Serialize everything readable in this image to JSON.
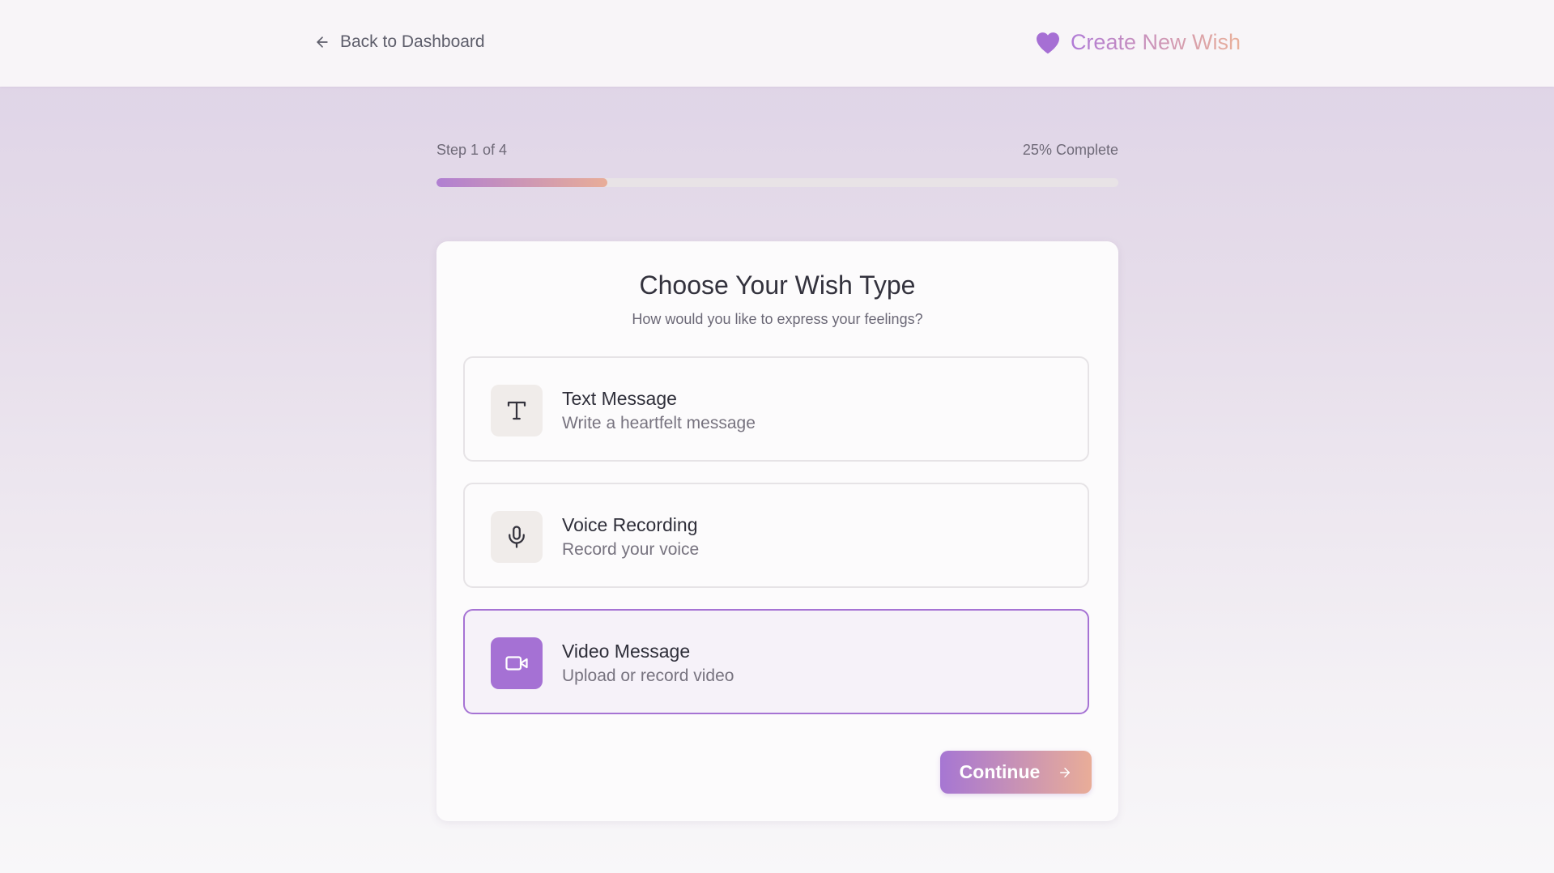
{
  "header": {
    "back_label": "Back to Dashboard",
    "title": "Create New Wish",
    "brand_icon": "heart-icon"
  },
  "progress": {
    "step_label": "Step 1 of 4",
    "percent_label": "25% Complete",
    "fraction": 0.25
  },
  "card": {
    "title": "Choose Your Wish Type",
    "subtitle": "How would you like to express your feelings?",
    "options": [
      {
        "title": "Text Message",
        "description": "Write a heartfelt message",
        "icon": "text-icon",
        "selected": false
      },
      {
        "title": "Voice Recording",
        "description": "Record your voice",
        "icon": "microphone-icon",
        "selected": false
      },
      {
        "title": "Video Message",
        "description": "Upload or record video",
        "icon": "video-camera-icon",
        "selected": true
      }
    ],
    "continue_label": "Continue"
  },
  "colors": {
    "accent": "#a673d4",
    "gradient_start": "#b07fd2",
    "gradient_end": "#e8ad98"
  }
}
